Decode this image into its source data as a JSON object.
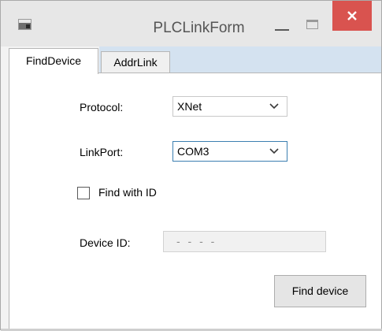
{
  "window": {
    "title": "PLCLinkForm",
    "icon": "app-icon",
    "close_color": "#d9534f"
  },
  "tabs": [
    {
      "label": "FindDevice",
      "active": true
    },
    {
      "label": "AddrLink",
      "active": false
    }
  ],
  "form": {
    "protocol_label": "Protocol:",
    "protocol_value": "XNet",
    "linkport_label": "LinkPort:",
    "linkport_value": "COM3",
    "find_with_id_label": "Find with ID",
    "find_with_id_checked": false,
    "device_id_label": "Device ID:",
    "device_id_placeholder": "- - - -",
    "find_button_label": "Find device"
  }
}
